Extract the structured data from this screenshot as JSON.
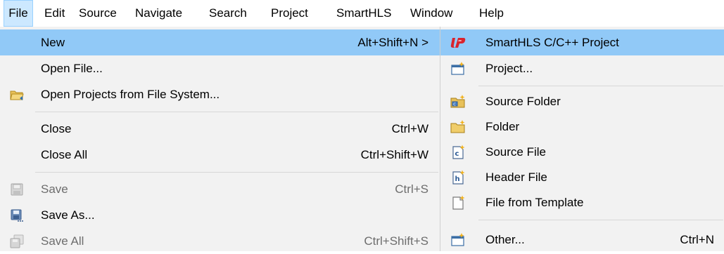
{
  "menubar": {
    "items": [
      "File",
      "Edit",
      "Source",
      "Navigate",
      "Search",
      "Project",
      "SmartHLS",
      "Window",
      "Help"
    ]
  },
  "file_menu": {
    "items": [
      {
        "label": "New",
        "shortcut": "Alt+Shift+N >",
        "icon": "none",
        "state": "selected"
      },
      {
        "label": "Open File...",
        "shortcut": "",
        "icon": "none",
        "state": "enabled"
      },
      {
        "label": "Open Projects from File System...",
        "shortcut": "",
        "icon": "folder-open-icon",
        "state": "enabled"
      },
      {
        "label": "Close",
        "shortcut": "Ctrl+W",
        "icon": "none",
        "state": "enabled"
      },
      {
        "label": "Close All",
        "shortcut": "Ctrl+Shift+W",
        "icon": "none",
        "state": "enabled"
      },
      {
        "label": "Save",
        "shortcut": "Ctrl+S",
        "icon": "save-icon",
        "state": "disabled"
      },
      {
        "label": "Save As...",
        "shortcut": "",
        "icon": "save-as-icon",
        "state": "enabled"
      },
      {
        "label": "Save All",
        "shortcut": "Ctrl+Shift+S",
        "icon": "save-all-icon",
        "state": "disabled"
      }
    ]
  },
  "new_submenu": {
    "items": [
      {
        "label": "SmartHLS C/C++ Project",
        "shortcut": "",
        "icon": "smarthls-project-icon",
        "state": "selected"
      },
      {
        "label": "Project...",
        "shortcut": "",
        "icon": "new-project-icon",
        "state": "enabled"
      },
      {
        "label": "Source Folder",
        "shortcut": "",
        "icon": "source-folder-icon",
        "state": "enabled"
      },
      {
        "label": "Folder",
        "shortcut": "",
        "icon": "folder-icon",
        "state": "enabled"
      },
      {
        "label": "Source File",
        "shortcut": "",
        "icon": "source-file-icon",
        "state": "enabled"
      },
      {
        "label": "Header File",
        "shortcut": "",
        "icon": "header-file-icon",
        "state": "enabled"
      },
      {
        "label": "File from Template",
        "shortcut": "",
        "icon": "template-file-icon",
        "state": "enabled"
      },
      {
        "label": "Other...",
        "shortcut": "Ctrl+N",
        "icon": "other-wizard-icon",
        "state": "enabled"
      }
    ]
  },
  "colors": {
    "menu_bg": "#f2f2f2",
    "selection": "#91c9f7",
    "menubar_active": "#cce8ff",
    "disabled_text": "#6d6d6d"
  }
}
